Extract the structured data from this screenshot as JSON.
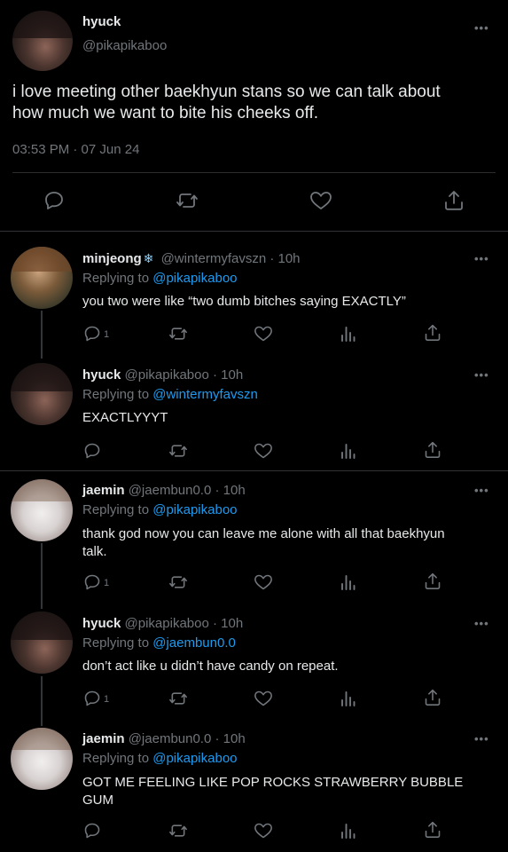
{
  "main_tweet": {
    "name": "hyuck",
    "handle": "@pikapikaboo",
    "text_line1": "i love meeting other baekhyun stans so we can talk about",
    "text_line2": "how much we want to bite his cheeks off.",
    "timestamp": "03:53 PM · 07 Jun 24"
  },
  "replies": [
    {
      "name": "minjeong",
      "badge": "❄",
      "meta": "@wintermyfavszn · 10h",
      "replying_prefix": "Replying to",
      "replying_to": "@pikapikaboo",
      "text_lines": [
        "you two were like “two dumb bitches saying EXACTLY”"
      ],
      "reply_count": "1"
    },
    {
      "name": "hyuck",
      "meta": "@pikapikaboo · 10h",
      "replying_prefix": "Replying to",
      "replying_to": "@wintermyfavszn",
      "text_lines": [
        "EXACTLYYYT"
      ],
      "reply_count": ""
    },
    {
      "name": "jaemin",
      "meta": "@jaembun0.0 · 10h",
      "replying_prefix": "Replying to",
      "replying_to": "@pikapikaboo",
      "text_lines": [
        "thank god now you can leave me alone with all that baekhyun",
        "talk."
      ],
      "reply_count": "1"
    },
    {
      "name": "hyuck",
      "meta": "@pikapikaboo · 10h",
      "replying_prefix": "Replying to",
      "replying_to": "@jaembun0.0",
      "text_lines": [
        "don’t act like u didn’t have candy on repeat."
      ],
      "reply_count": "1"
    },
    {
      "name": "jaemin",
      "meta": "@jaembun0.0 · 10h",
      "replying_prefix": "Replying to",
      "replying_to": "@pikapikaboo",
      "text_lines": [
        "GOT ME FEELING LIKE POP ROCKS STRAWBERRY BUBBLE",
        "GUM"
      ],
      "reply_count": ""
    }
  ],
  "more_label": "•••",
  "colors": {
    "background": "#000000",
    "text": "#e7e9ea",
    "muted": "#71767b",
    "link": "#1d9bf0",
    "divider": "#2f3336"
  },
  "icons": [
    "reply-icon",
    "retweet-icon",
    "like-icon",
    "analytics-icon",
    "share-icon",
    "more-icon"
  ]
}
